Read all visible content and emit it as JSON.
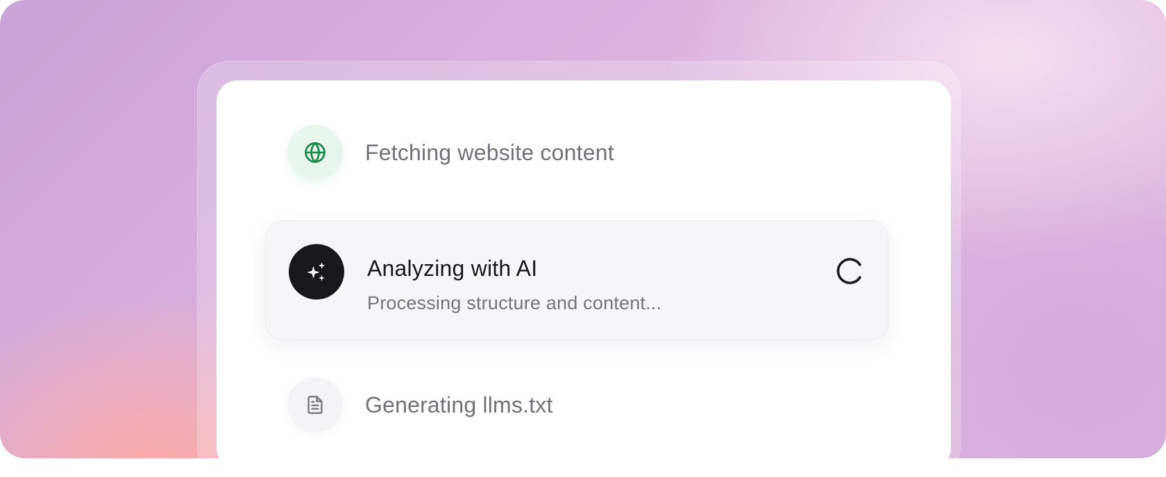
{
  "steps": [
    {
      "label": "Fetching website content",
      "icon": "globe-icon",
      "status": "complete",
      "accent": "#1f8a4c"
    },
    {
      "title": "Analyzing with AI",
      "subtitle": "Processing structure and content...",
      "icon": "sparkles-icon",
      "status": "in-progress"
    },
    {
      "label": "Generating llms.txt",
      "icon": "document-icon",
      "status": "pending"
    }
  ],
  "colors": {
    "card_background": "#ffffff",
    "active_panel": "#f6f6f8",
    "active_icon_background": "#17171c",
    "completed_icon_background": "#e8f6ec",
    "pending_icon_background": "#f4f4f6",
    "muted_text": "#717178",
    "primary_text": "#18181b"
  }
}
